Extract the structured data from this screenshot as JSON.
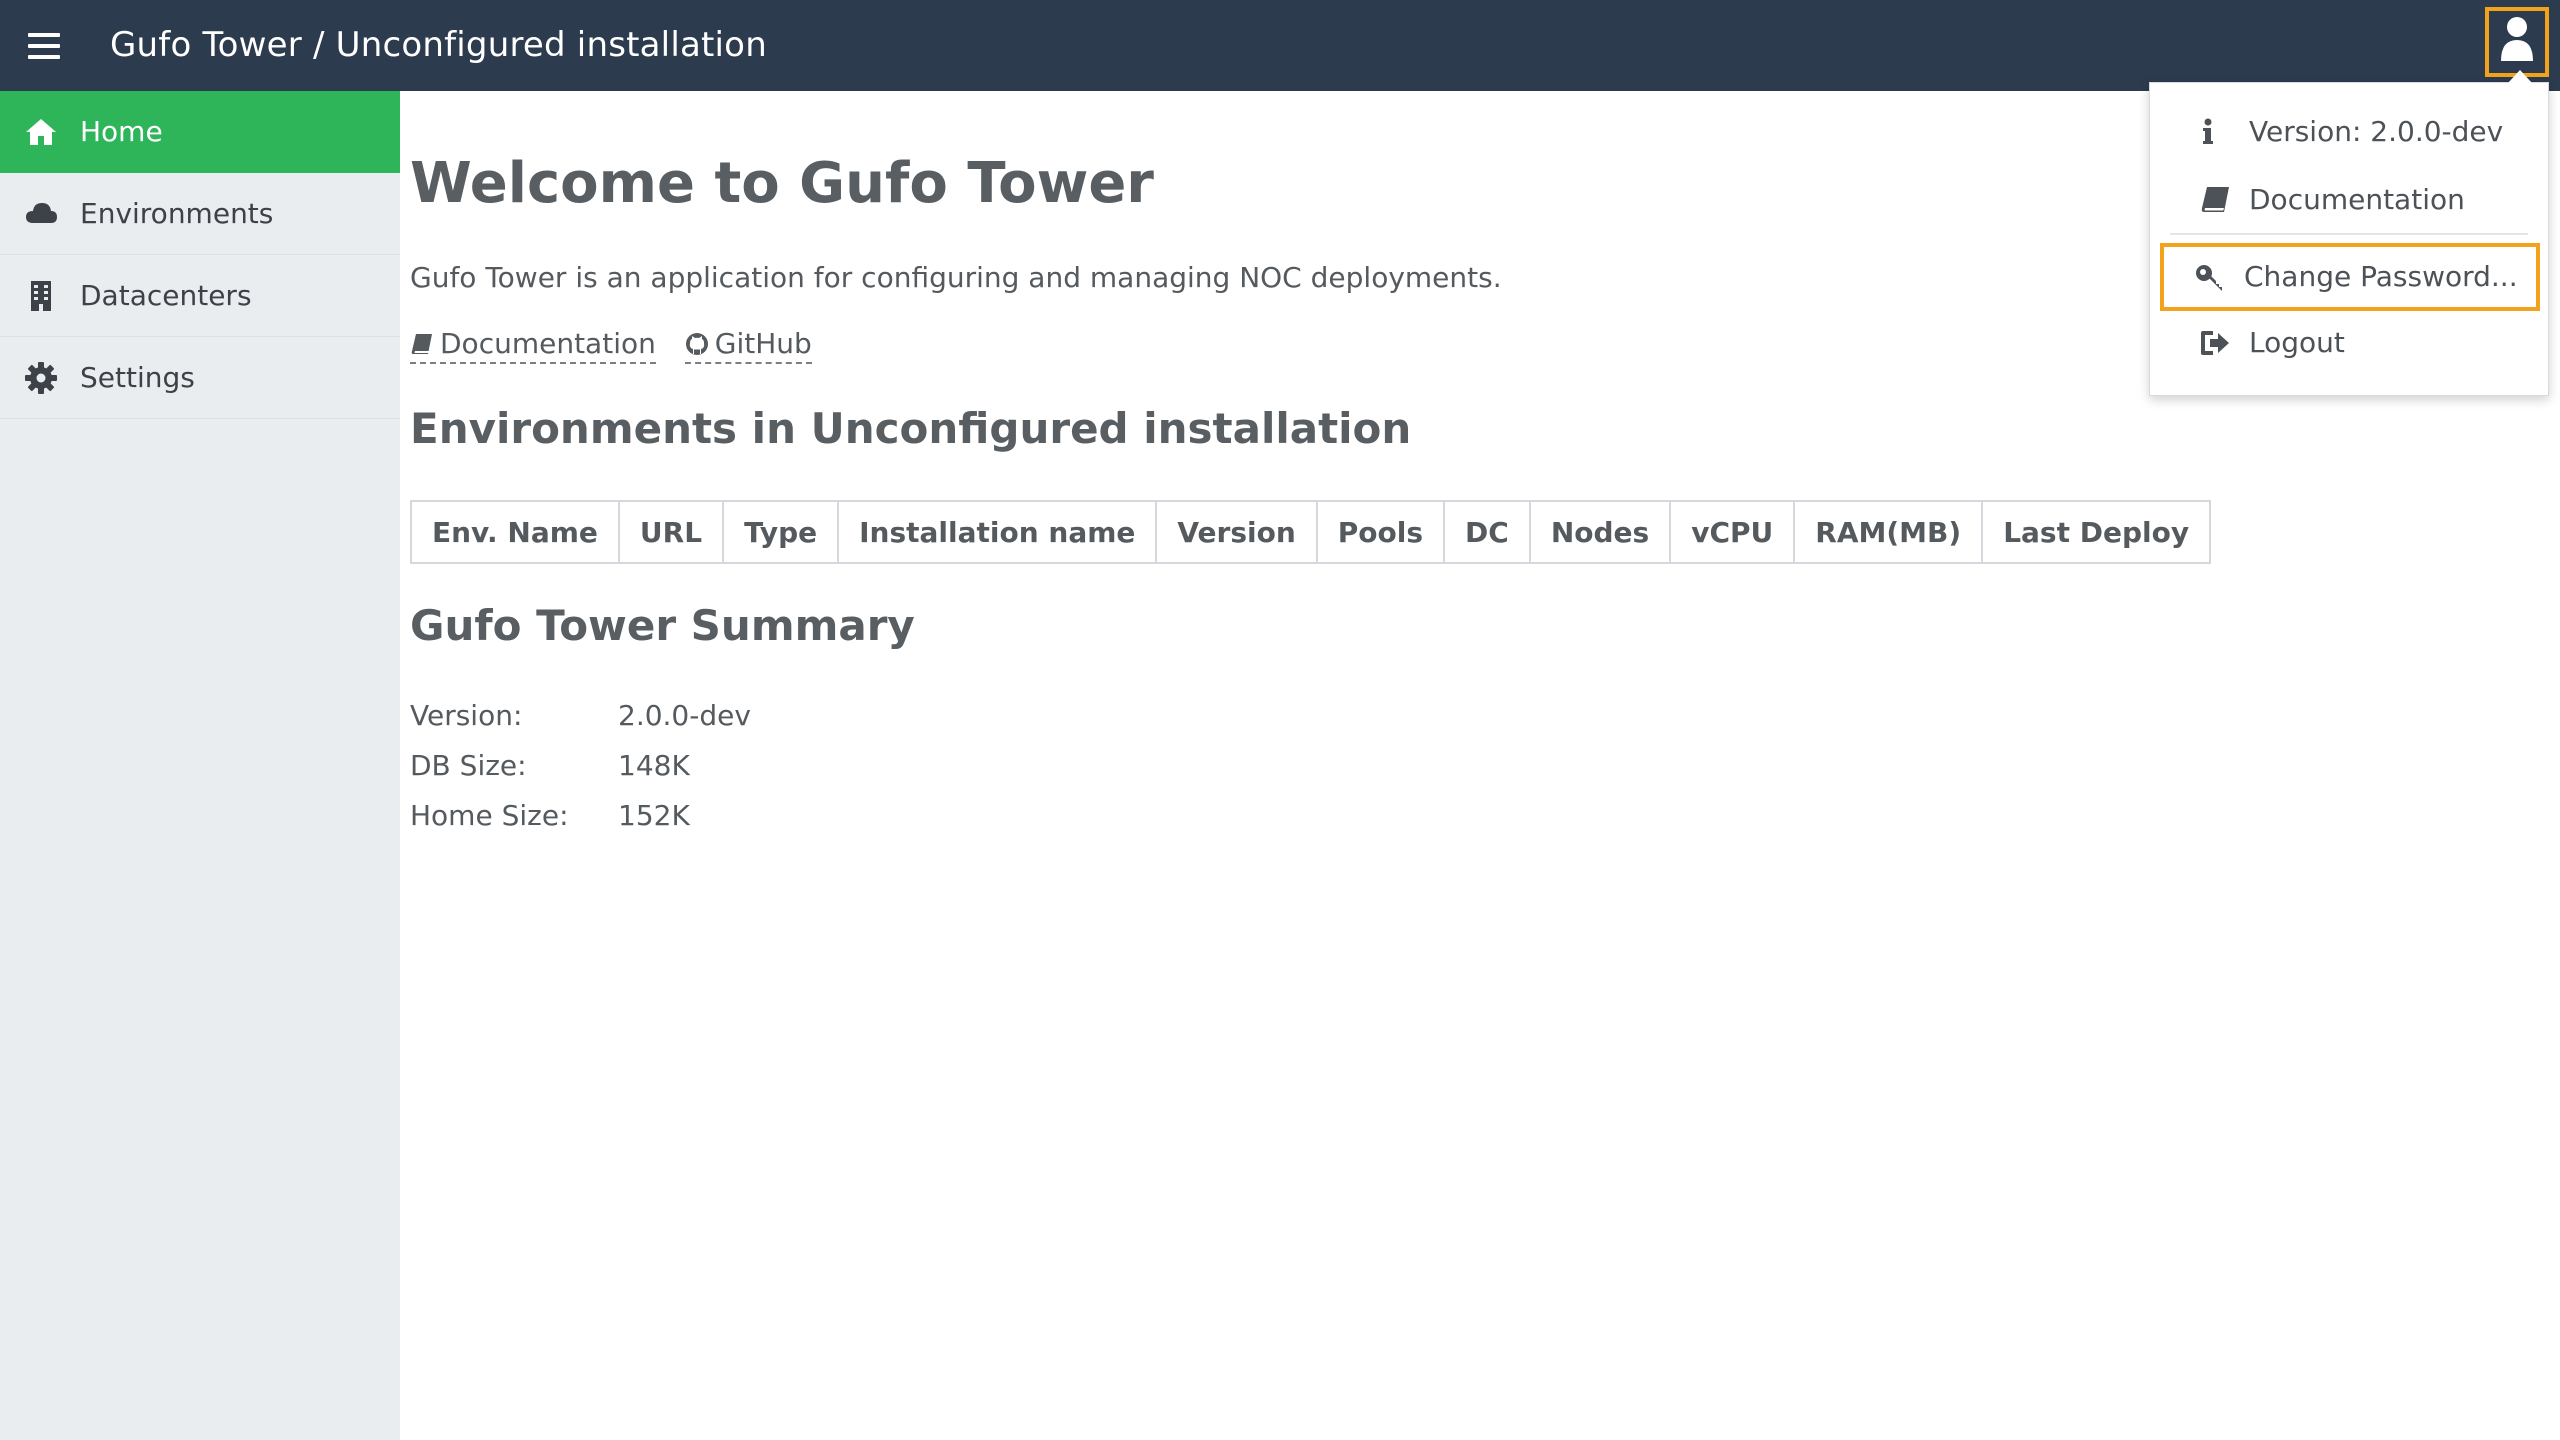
{
  "header": {
    "title": "Gufo Tower / Unconfigured installation",
    "menu_icon": "hamburger-menu-icon",
    "user_icon": "user-icon"
  },
  "sidebar": {
    "items": [
      {
        "label": "Home",
        "icon": "home-icon",
        "active": true
      },
      {
        "label": "Environments",
        "icon": "cloud-icon",
        "active": false
      },
      {
        "label": "Datacenters",
        "icon": "building-icon",
        "active": false
      },
      {
        "label": "Settings",
        "icon": "gear-icon",
        "active": false
      }
    ]
  },
  "main": {
    "title": "Welcome to Gufo Tower",
    "intro": "Gufo Tower is an application for configuring and managing NOC deployments.",
    "links": [
      {
        "label": "Documentation",
        "icon": "book-icon"
      },
      {
        "label": "GitHub",
        "icon": "github-icon"
      }
    ],
    "environments_heading": "Environments in Unconfigured installation",
    "table_columns": [
      "Env. Name",
      "URL",
      "Type",
      "Installation name",
      "Version",
      "Pools",
      "DC",
      "Nodes",
      "vCPU",
      "RAM(MB)",
      "Last Deploy"
    ],
    "summary_heading": "Gufo Tower Summary",
    "summary": [
      {
        "key": "Version:",
        "value": "2.0.0-dev"
      },
      {
        "key": "DB Size:",
        "value": "148K"
      },
      {
        "key": "Home Size:",
        "value": "152K"
      }
    ]
  },
  "user_menu": {
    "items": [
      {
        "label": "Version: 2.0.0-dev",
        "icon": "info-icon"
      },
      {
        "label": "Documentation",
        "icon": "book-icon"
      },
      {
        "label": "Change Password...",
        "icon": "key-icon",
        "focused": true
      },
      {
        "label": "Logout",
        "icon": "logout-icon"
      }
    ]
  },
  "colors": {
    "topbar": "#2d3b4e",
    "sidebar": "#eaedf0",
    "active_nav": "#2eb55a",
    "focus_outline": "#f3a21b",
    "text": "#555a5f"
  }
}
